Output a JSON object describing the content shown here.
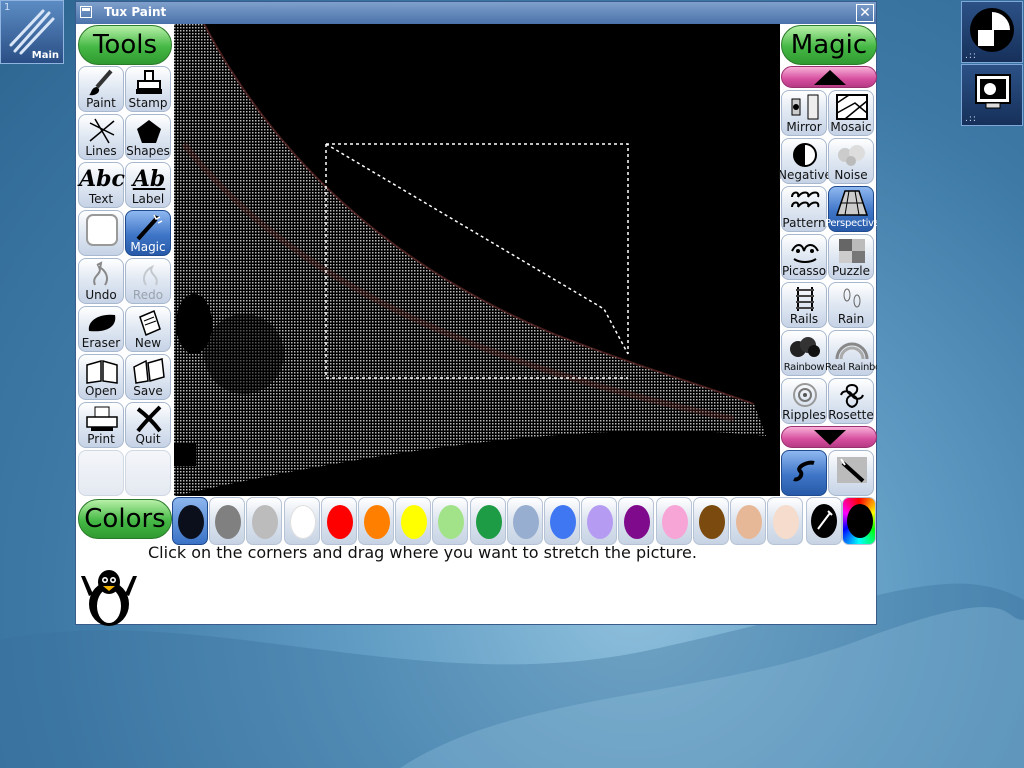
{
  "desktop": {
    "launcher": {
      "label": "Main",
      "number": "1"
    },
    "tray_dots": ".::"
  },
  "window": {
    "title": "Tux Paint",
    "close_glyph": "✕"
  },
  "tools": {
    "header": "Tools",
    "items": [
      {
        "label": "Paint",
        "icon": "paint-brush-icon"
      },
      {
        "label": "Stamp",
        "icon": "stamp-icon"
      },
      {
        "label": "Lines",
        "icon": "lines-icon"
      },
      {
        "label": "Shapes",
        "icon": "pentagon-icon"
      },
      {
        "label": "Text",
        "icon": "text-abc-icon",
        "glyph": "Abc"
      },
      {
        "label": "Label",
        "icon": "label-abc-icon",
        "glyph": "Ab"
      },
      {
        "label": "",
        "icon": "fill-icon"
      },
      {
        "label": "Magic",
        "icon": "magic-wand-icon"
      },
      {
        "label": "Undo",
        "icon": "undo-icon"
      },
      {
        "label": "Redo",
        "icon": "redo-icon"
      },
      {
        "label": "Eraser",
        "icon": "eraser-icon"
      },
      {
        "label": "New",
        "icon": "new-page-icon"
      },
      {
        "label": "Open",
        "icon": "open-book-icon"
      },
      {
        "label": "Save",
        "icon": "save-icon"
      },
      {
        "label": "Print",
        "icon": "printer-icon"
      },
      {
        "label": "Quit",
        "icon": "quit-x-icon"
      }
    ]
  },
  "magic": {
    "header": "Magic",
    "items": [
      {
        "label": "Mirror",
        "icon": "mirror-icon"
      },
      {
        "label": "Mosaic",
        "icon": "mosaic-icon"
      },
      {
        "label": "Negative",
        "icon": "negative-icon"
      },
      {
        "label": "Noise",
        "icon": "noise-icon"
      },
      {
        "label": "Pattern",
        "icon": "pattern-icon"
      },
      {
        "label": "Perspective",
        "icon": "perspective-icon"
      },
      {
        "label": "Picasso",
        "icon": "picasso-icon"
      },
      {
        "label": "Puzzle",
        "icon": "puzzle-icon"
      },
      {
        "label": "Rails",
        "icon": "rails-icon"
      },
      {
        "label": "Rain",
        "icon": "rain-icon"
      },
      {
        "label": "Rainbow",
        "icon": "rainbow-blobs-icon"
      },
      {
        "label": "Real Rainbow",
        "icon": "real-rainbow-icon"
      },
      {
        "label": "Ripples",
        "icon": "ripples-icon"
      },
      {
        "label": "Rosette",
        "icon": "rosette-icon"
      }
    ],
    "selected": "Perspective",
    "mode_buttons": [
      {
        "icon": "paint-mode-icon"
      },
      {
        "icon": "fullscreen-mode-icon"
      }
    ]
  },
  "colors": {
    "header": "Colors",
    "palette": [
      "#0b0f1c",
      "#808080",
      "#bcbcbc",
      "#ffffff",
      "#ff0000",
      "#ff7f00",
      "#ffff00",
      "#a2e38a",
      "#1e9b45",
      "#97aed0",
      "#3f77f2",
      "#b59cf2",
      "#7f0b8c",
      "#f6a5d6",
      "#7a4a0e",
      "#e6b898",
      "#f6dccc"
    ],
    "selected_index": 0
  },
  "status": {
    "instruction": "Click on the corners and drag where you want to stretch the picture."
  }
}
